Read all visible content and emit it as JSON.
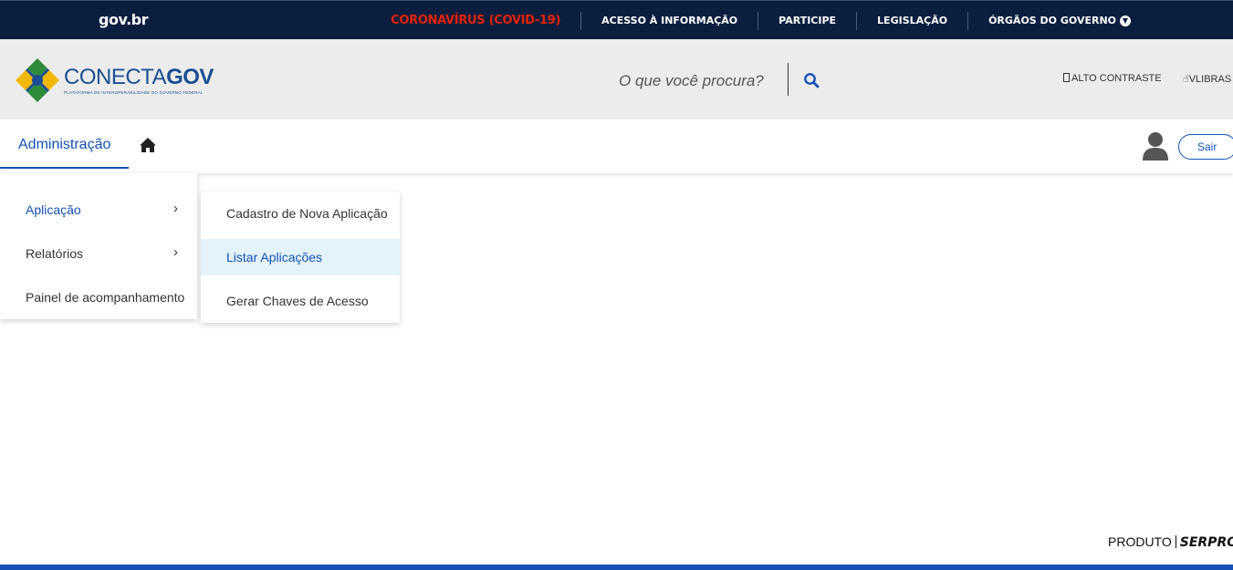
{
  "gov_bar": {
    "logo": "gov.br",
    "links": [
      {
        "label": "CORONAVÍRUS (COVID-19)",
        "color": "#e52207"
      },
      {
        "label": "ACESSO À INFORMAÇÃO"
      },
      {
        "label": "PARTICIPE"
      },
      {
        "label": "LEGISLAÇÃO"
      },
      {
        "label": "ÓRGÃOS DO GOVERNO"
      }
    ]
  },
  "header": {
    "brand_name_part1": "CONECTA",
    "brand_name_part2": "GOV",
    "brand_subtitle": "PLATAFORMA DE INTEROPERABILIDADE DO GOVERNO FEDERAL",
    "search_placeholder": "O que você procura?",
    "high_contrast": "ALTO CONTRASTE",
    "libras": "VLIBRAS"
  },
  "nav": {
    "active_tab": "Administração",
    "logout": "Sair"
  },
  "menu": {
    "items": [
      {
        "label": "Aplicação",
        "has_submenu": true,
        "active": true
      },
      {
        "label": "Relatórios",
        "has_submenu": true
      },
      {
        "label": "Painel de acompanhamento"
      }
    ],
    "submenu": [
      {
        "label": "Cadastro de Nova Aplicação"
      },
      {
        "label": "Listar Aplicações",
        "highlighted": true
      },
      {
        "label": "Gerar Chaves de Acesso"
      }
    ]
  },
  "footer": {
    "produto": "PRODUTO",
    "brand": "SERPRO"
  },
  "colors": {
    "gov_bar": "#0c1e3f",
    "accent": "#1351b4",
    "covid": "#e52207",
    "header_bg": "#ececec",
    "highlight_bg": "#e4f2fc"
  }
}
